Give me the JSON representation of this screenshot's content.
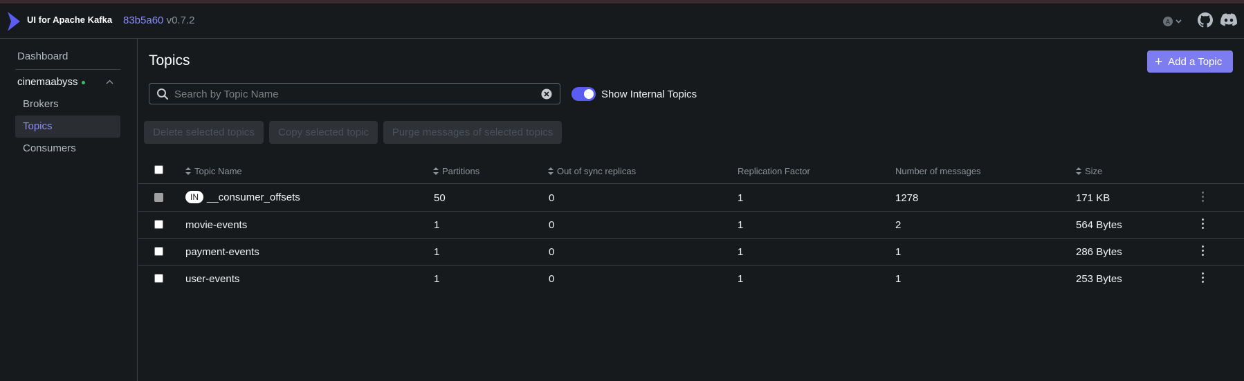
{
  "header": {
    "app_title": "UI for Apache Kafka",
    "commit_hash": "83b5a60",
    "version": "v0.7.2",
    "icons": [
      "logo-icon",
      "user-avatar-icon",
      "chevron-down-icon",
      "github-icon",
      "discord-icon"
    ],
    "avatar_letter": "A"
  },
  "sidebar": {
    "dashboard": "Dashboard",
    "cluster_name": "cinemaabyss",
    "cluster_status_color": "#3ABE6C",
    "items": [
      {
        "label": "Brokers"
      },
      {
        "label": "Topics"
      },
      {
        "label": "Consumers"
      }
    ],
    "active_item": "Topics",
    "active_color": "#8B8CF6"
  },
  "main": {
    "title": "Topics",
    "add_button": "Add a Topic",
    "search_placeholder": "Search by Topic Name",
    "show_internal_label": "Show Internal Topics",
    "show_internal_enabled": true,
    "bulk_actions": [
      "Delete selected topics",
      "Copy selected topic",
      "Purge messages of selected topics"
    ],
    "columns": [
      "Topic Name",
      "Partitions",
      "Out of sync replicas",
      "Replication Factor",
      "Number of messages",
      "Size"
    ],
    "rows": [
      {
        "internal_badge": "IN",
        "name": "__consumer_offsets",
        "partitions": "50",
        "out_of_sync": "0",
        "replication": "1",
        "messages": "1278",
        "size": "171 KB"
      },
      {
        "internal_badge": "",
        "name": "movie-events",
        "partitions": "1",
        "out_of_sync": "0",
        "replication": "1",
        "messages": "2",
        "size": "564 Bytes"
      },
      {
        "internal_badge": "",
        "name": "payment-events",
        "partitions": "1",
        "out_of_sync": "0",
        "replication": "1",
        "messages": "1",
        "size": "286 Bytes"
      },
      {
        "internal_badge": "",
        "name": "user-events",
        "partitions": "1",
        "out_of_sync": "0",
        "replication": "1",
        "messages": "1",
        "size": "253 Bytes"
      }
    ]
  },
  "colors": {
    "accent": "#7D7DF0",
    "background": "#171A1C"
  }
}
